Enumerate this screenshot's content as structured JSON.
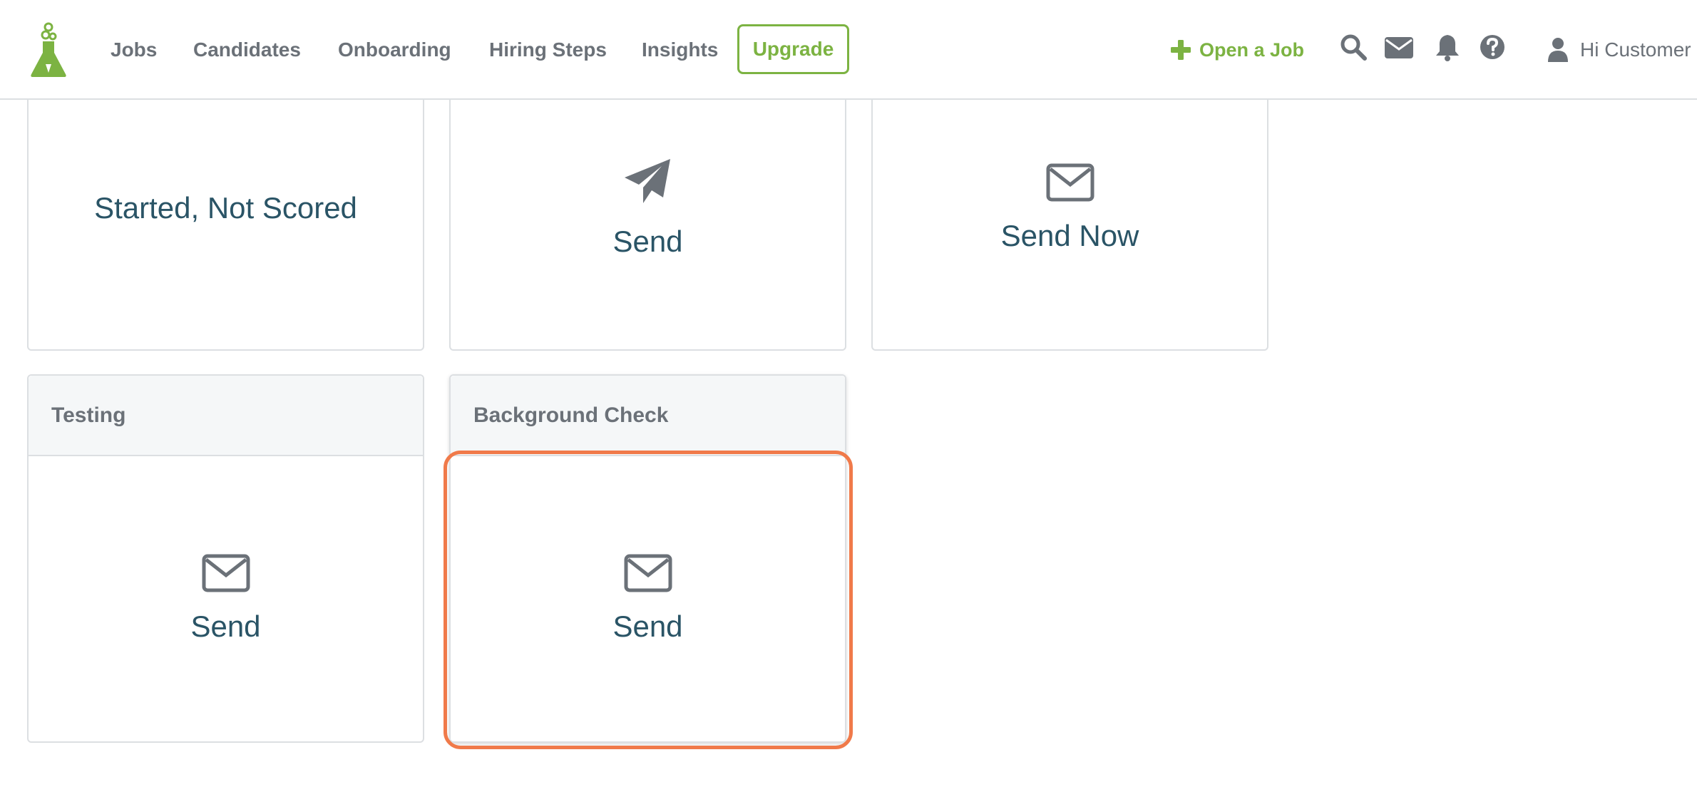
{
  "nav": {
    "items": [
      "Jobs",
      "Candidates",
      "Onboarding",
      "Hiring Steps",
      "Insights"
    ],
    "upgrade_label": "Upgrade",
    "open_job_label": "Open a Job",
    "greeting": "Hi Customer"
  },
  "icons": {
    "logo": "flask-logo-icon",
    "plus": "plus-icon",
    "search": "search-icon",
    "mail": "envelope-icon",
    "bell": "bell-icon",
    "help": "question-circle-icon",
    "user": "user-icon",
    "paper_plane": "paper-plane-icon",
    "envelope": "envelope-outline-icon"
  },
  "colors": {
    "brand_green": "#7cb342",
    "nav_text": "#6b7178",
    "card_text": "#2a5466",
    "highlight": "#f07a4a"
  },
  "cards": {
    "started": {
      "label": "Started, Not Scored"
    },
    "send_plane": {
      "label": "Send"
    },
    "send_now": {
      "label": "Send Now"
    },
    "testing": {
      "header": "Testing",
      "label": "Send"
    },
    "background": {
      "header": "Background Check",
      "label": "Send"
    }
  }
}
